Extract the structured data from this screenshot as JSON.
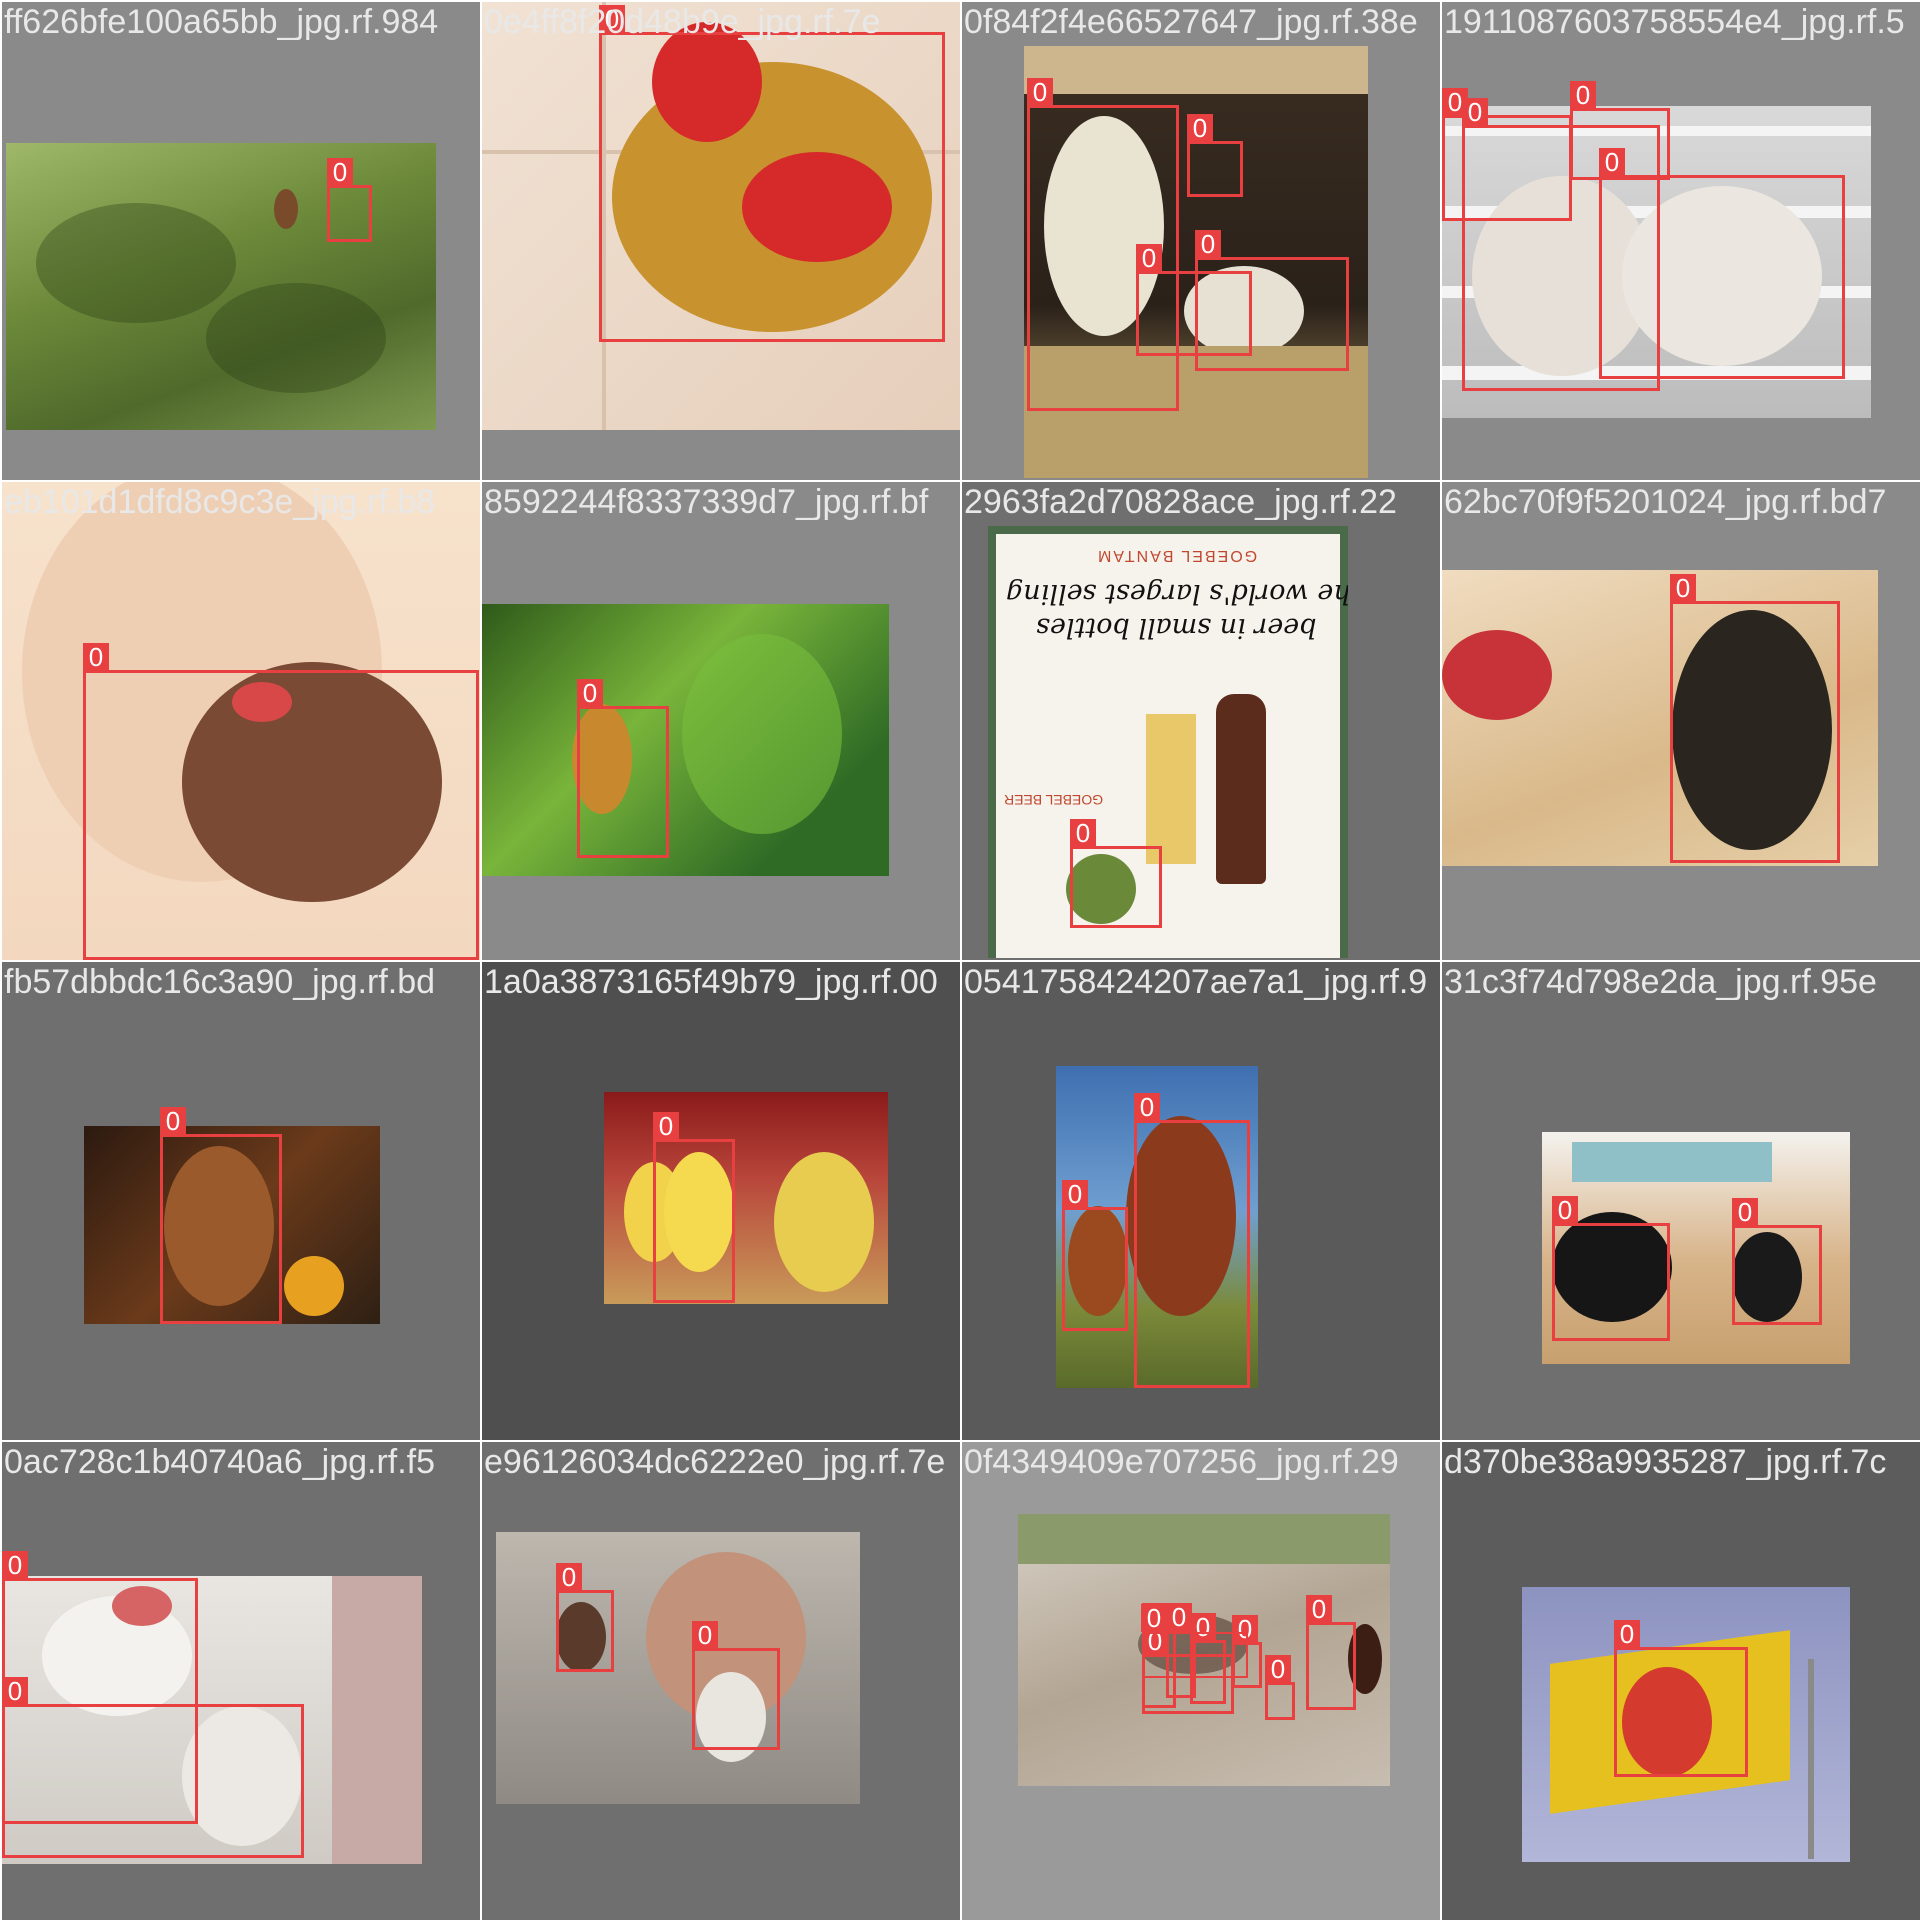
{
  "mosaic": {
    "box_color": "#e84040",
    "tiles": [
      {
        "title": "ff626bfe100a65bb_jpg.rf.984",
        "labels": [
          "0"
        ]
      },
      {
        "title": "0e4ff8f20d48b9e_jpg.rf.7e",
        "labels": [
          "0"
        ]
      },
      {
        "title": "0f84f2f4e66527647_jpg.rf.38e",
        "labels": [
          "0",
          "0",
          "0",
          "0"
        ]
      },
      {
        "title": "1911087603758554e4_jpg.rf.5",
        "labels": [
          "0",
          "0",
          "0",
          "0"
        ]
      },
      {
        "title": "eb101d1dfd8c9c3e_jpg.rf.b8",
        "labels": [
          "0"
        ]
      },
      {
        "title": "8592244f8337339d7_jpg.rf.bf",
        "labels": [
          "0"
        ]
      },
      {
        "title": "2963fa2d70828ace_jpg.rf.22",
        "labels": [
          "0"
        ],
        "poster": {
          "heading": "GOEBEL BANTAM",
          "line1": "The world's largest selling",
          "line2": "beer in small bottles",
          "footer": "GOEBEL BEER"
        }
      },
      {
        "title": "62bc70f9f5201024_jpg.rf.bd7",
        "labels": [
          "0"
        ]
      },
      {
        "title": "fb57dbbdc16c3a90_jpg.rf.bd",
        "labels": [
          "0"
        ]
      },
      {
        "title": "1a0a3873165f49b79_jpg.rf.00",
        "labels": [
          "0"
        ]
      },
      {
        "title": "0541758424207ae7a1_jpg.rf.9",
        "labels": [
          "0",
          "0"
        ]
      },
      {
        "title": "31c3f74d798e2da_jpg.rf.95e",
        "labels": [
          "0",
          "0"
        ]
      },
      {
        "title": "0ac728c1b40740a6_jpg.rf.f5",
        "labels": [
          "0",
          "0"
        ]
      },
      {
        "title": "e96126034dc6222e0_jpg.rf.7e",
        "labels": [
          "0",
          "0"
        ]
      },
      {
        "title": "0f4349409e707256_jpg.rf.29",
        "labels": [
          "0",
          "0",
          "0",
          "0",
          "0",
          "0",
          "0",
          "0"
        ]
      },
      {
        "title": "d370be38a9935287_jpg.rf.7c",
        "labels": [
          "0"
        ]
      }
    ]
  }
}
